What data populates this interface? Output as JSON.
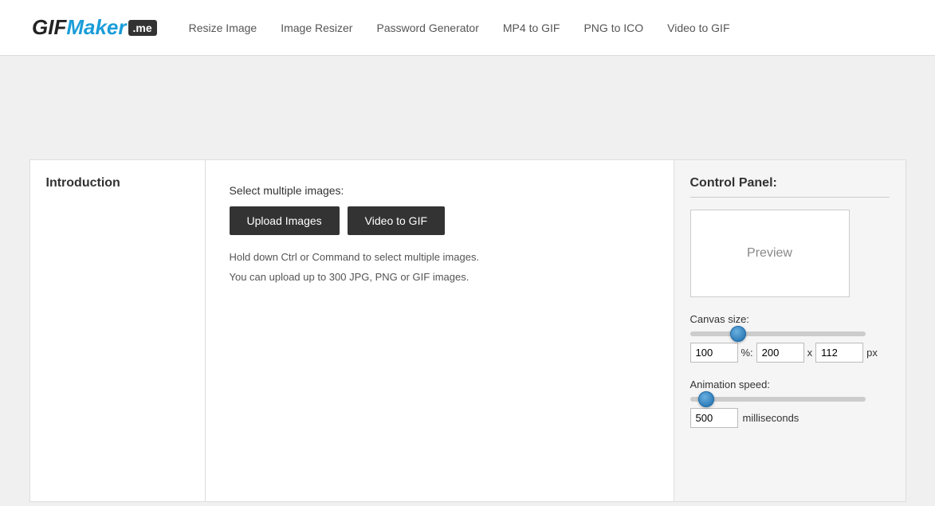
{
  "header": {
    "logo": {
      "gif": "GIF",
      "maker": "Maker",
      "me": ".me"
    },
    "nav": [
      {
        "label": "Resize Image",
        "href": "#"
      },
      {
        "label": "Image Resizer",
        "href": "#"
      },
      {
        "label": "Password Generator",
        "href": "#"
      },
      {
        "label": "MP4 to GIF",
        "href": "#"
      },
      {
        "label": "PNG to ICO",
        "href": "#"
      },
      {
        "label": "Video to GIF",
        "href": "#"
      }
    ]
  },
  "sidebar": {
    "title": "Introduction"
  },
  "center": {
    "select_label": "Select multiple images:",
    "upload_button": "Upload Images",
    "video_button": "Video to GIF",
    "hint1": "Hold down Ctrl or Command to select multiple images.",
    "hint2": "You can upload up to 300 JPG, PNG or GIF images."
  },
  "control_panel": {
    "title": "Control Panel:",
    "preview_text": "Preview",
    "canvas_label": "Canvas size:",
    "canvas_percent": "100",
    "canvas_percent_symbol": "%:",
    "canvas_width": "200",
    "canvas_x": "x",
    "canvas_height": "112",
    "canvas_unit": "px",
    "animation_label": "Animation speed:",
    "animation_value": "500",
    "animation_unit": "milliseconds"
  }
}
